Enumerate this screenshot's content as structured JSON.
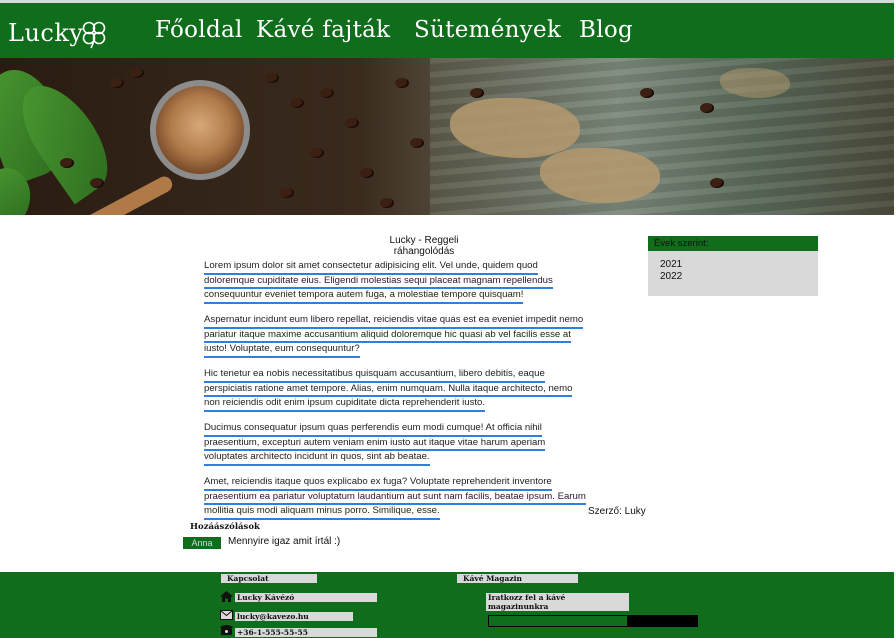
{
  "brand": {
    "name": "Lucky",
    "logo_icon": "four-leaf-clover-icon"
  },
  "nav": {
    "items": [
      "Főoldal",
      "Kávé fajták",
      "Sütemények",
      "Blog"
    ]
  },
  "colors": {
    "primary": "#0f6d1c",
    "link_underline": "#2f7fe0",
    "panel": "#d9d9d9"
  },
  "post": {
    "title_line1": "Lucky - Reggeli",
    "title_line2": "ráhangolódás",
    "paragraphs": [
      [
        "Lorem ipsum dolor sit amet consectetur adipisicing elit. Vel unde, quidem quod",
        "doloremque cupiditate eius. Eligendi molestias sequi placeat magnam repellendus",
        "consequuntur eveniet tempora autem fuga, a molestiae tempore quisquam!"
      ],
      [
        "Aspernatur incidunt eum libero repellat, reiciendis vitae quas est ea eveniet impedit nemo",
        "pariatur itaque maxime accusantium aliquid doloremque hic quasi ab vel facilis esse at",
        "iusto! Voluptate, eum consequuntur?"
      ],
      [
        "Hic tenetur ea nobis necessitatibus quisquam accusantium, libero debitis, eaque",
        "perspiciatis ratione amet tempore. Alias, enim numquam. Nulla itaque architecto, nemo",
        "non reiciendis odit enim ipsum cupiditate dicta reprehenderit iusto."
      ],
      [
        "Ducimus consequatur ipsum quas perferendis eum modi cumque! At officia nihil",
        "praesentium, excepturi autem veniam enim iusto aut itaque vitae harum aperiam",
        "voluptates architecto incidunt in quos, sint ab beatae."
      ],
      [
        "Amet, reiciendis itaque quos explicabo ex fuga? Voluptate reprehenderit inventore",
        "praesentium ea pariatur voluptatum laudantium aut sunt nam facilis, beatae ipsum. Earum",
        "mollitia quis modi aliquam minus porro. Similique, esse."
      ]
    ],
    "author": "Szerző: Luky"
  },
  "sidebar": {
    "heading": "Évek szerint:",
    "years": [
      "2021",
      "2022"
    ]
  },
  "comments": {
    "heading": "Hozáászólások",
    "items": [
      {
        "name": "Anna",
        "text": "Mennyire igaz amit írtál :)"
      }
    ]
  },
  "footer": {
    "contact_heading": "Kapcsolat",
    "contact_items": [
      {
        "icon": "home-icon",
        "text": "Lucky Kávézó"
      },
      {
        "icon": "envelope-icon",
        "text": "lucky@kavezo.hu"
      },
      {
        "icon": "phone-icon",
        "text": "+36-1-555-55-55"
      }
    ],
    "magazine_heading": "Kávé Magazin",
    "magazine_text": "Iratkozz fel a kávé magazinunkra"
  }
}
